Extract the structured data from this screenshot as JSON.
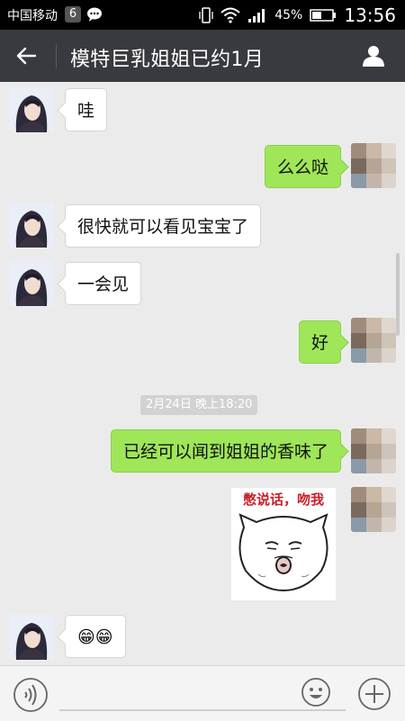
{
  "status_bar": {
    "carrier": "中国移动",
    "notification_count": "6",
    "battery_level": "45%",
    "time": "13:56"
  },
  "top_bar": {
    "title": "模特巨乳姐姐已约1月"
  },
  "messages": [
    {
      "side": "incoming",
      "text": "哇"
    },
    {
      "side": "outgoing",
      "text": "么么哒"
    },
    {
      "side": "incoming",
      "text": "很快就可以看见宝宝了"
    },
    {
      "side": "incoming",
      "text": "一会见"
    },
    {
      "side": "outgoing",
      "text": "好"
    },
    {
      "side": "outgoing",
      "text": "已经可以闻到姐姐的香味了"
    },
    {
      "side": "outgoing",
      "sticker": true,
      "sticker_text": "憋说话，吻我"
    },
    {
      "side": "incoming",
      "text": "😁😁"
    }
  ],
  "timestamp": "2月24日 晚上18:20",
  "colors": {
    "status_bar_bg": "#000000",
    "top_bar_bg": "#393a3f",
    "chat_bg": "#ebebeb",
    "outgoing_bubble": "#9fe658",
    "incoming_bubble": "#ffffff"
  },
  "icons": {
    "back": "back-arrow-icon",
    "profile": "person-icon",
    "voice": "voice-input-icon",
    "emoji": "emoji-icon",
    "more": "plus-icon"
  }
}
